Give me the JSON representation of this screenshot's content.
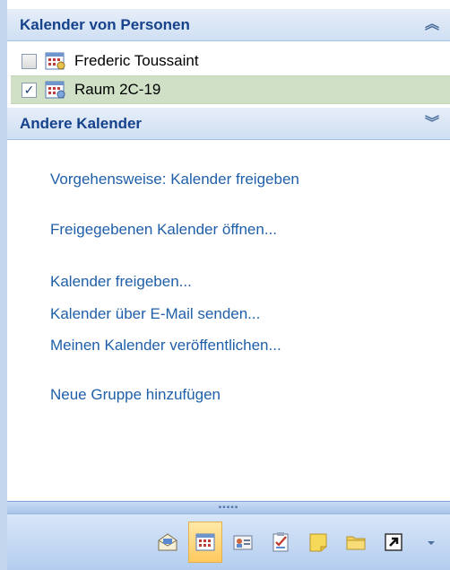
{
  "sections": {
    "people_calendars": {
      "title": "Kalender von Personen",
      "collapse_glyph": "⌃",
      "items": [
        {
          "label": "Frederic Toussaint",
          "checked": false
        },
        {
          "label": "Raum 2C-19",
          "checked": true
        }
      ]
    },
    "other_calendars": {
      "title": "Andere Kalender",
      "expand_glyph": "⌄"
    }
  },
  "links": [
    "Vorgehensweise: Kalender freigeben",
    "Freigegebenen Kalender öffnen...",
    "Kalender freigeben...",
    "Kalender über E-Mail senden...",
    "Meinen Kalender veröffentlichen...",
    "Neue Gruppe hinzufügen"
  ],
  "splitter": {
    "grip": "▪▪▪▪▪"
  },
  "toolbar": {
    "buttons": [
      {
        "icon": "mail-icon"
      },
      {
        "icon": "calendar-icon",
        "active": true
      },
      {
        "icon": "contacts-icon"
      },
      {
        "icon": "tasks-icon"
      },
      {
        "icon": "notes-icon"
      },
      {
        "icon": "folder-icon"
      },
      {
        "icon": "shortcut-icon"
      },
      {
        "icon": "configure-buttons-icon"
      }
    ]
  },
  "colors": {
    "header_text": "#15428b",
    "link_text": "#1f5fa9",
    "selected_row": "#cfe0c6",
    "active_button": "#ffc95e"
  }
}
